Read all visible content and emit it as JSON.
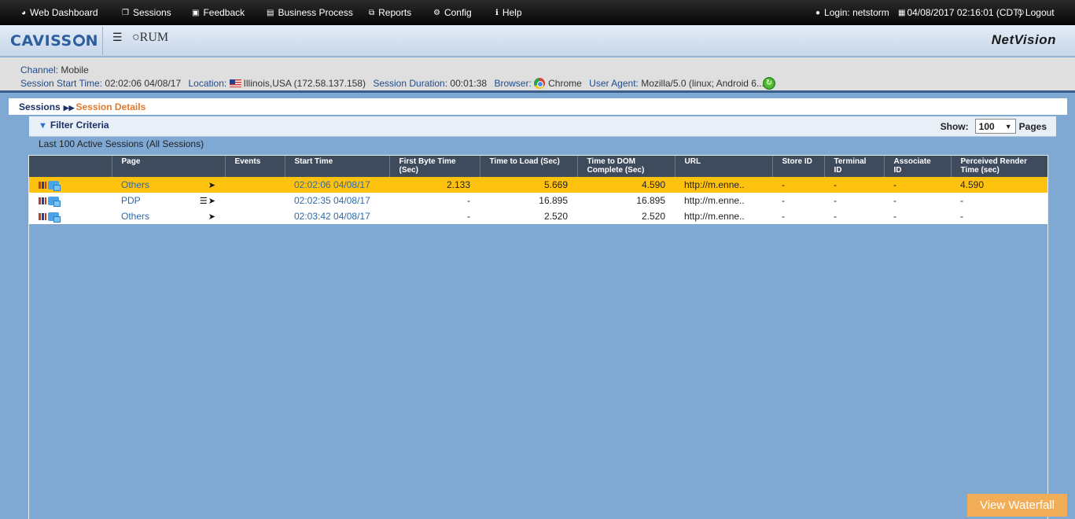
{
  "nav": {
    "items": [
      {
        "label": "Web Dashboard",
        "icon": "dashboard-icon",
        "glyph": "◕"
      },
      {
        "label": "Sessions",
        "icon": "sessions-icon",
        "glyph": "❐"
      },
      {
        "label": "Feedback",
        "icon": "feedback-icon",
        "glyph": "▣"
      },
      {
        "label": "Business Process",
        "icon": "business-process-icon",
        "glyph": "▤"
      },
      {
        "label": "Reports",
        "icon": "reports-icon",
        "glyph": "⧉"
      },
      {
        "label": "Config",
        "icon": "config-icon",
        "glyph": "⚙"
      },
      {
        "label": "Help",
        "icon": "help-icon",
        "glyph": "ℹ"
      }
    ],
    "login": "Login: netstorm",
    "datetime": "04/08/2017 02:16:01 (CDT)",
    "logout": "Logout"
  },
  "brand": {
    "logo_prefix": "CAVISS",
    "logo_suffix": "N",
    "rum": "RUM",
    "product": "NetVision"
  },
  "session": {
    "channel_label": "Channel:",
    "channel": "Mobile",
    "start_label": "Session Start Time:",
    "start": "02:02:06 04/08/17",
    "location_label": "Location:",
    "location": "Illinois,USA (172.58.137.158)",
    "duration_label": "Session Duration:",
    "duration": "00:01:38",
    "browser_label": "Browser:",
    "browser": "Chrome",
    "agent_label": "User Agent:",
    "agent": "Mozilla/5.0 (linux; Android 6...."
  },
  "breadcrumb": {
    "root": "Sessions",
    "current": "Session Details"
  },
  "filter": {
    "title": "Filter Criteria",
    "show_label": "Show:",
    "show_value": "100",
    "pages_label": "Pages"
  },
  "summary": "Last 100 Active Sessions (All Sessions)",
  "table": {
    "columns": [
      "",
      "Page",
      "Events",
      "Start Time",
      "First Byte Time (Sec)",
      "Time to Load (Sec)",
      "Time to DOM Complete (Sec)",
      "URL",
      "Store ID",
      "Terminal ID",
      "Associate ID",
      "Perceived Render Time (sec)"
    ],
    "rows": [
      {
        "page": "Others",
        "events": "",
        "start": "02:02:06 04/08/17",
        "first_byte": "2.133",
        "load": "5.669",
        "dom": "4.590",
        "url": "http://m.enne..",
        "store": "-",
        "terminal": "-",
        "associate": "-",
        "render": "4.590",
        "has_list": false
      },
      {
        "page": "PDP",
        "events": "",
        "start": "02:02:35 04/08/17",
        "first_byte": "-",
        "load": "16.895",
        "dom": "16.895",
        "url": "http://m.enne..",
        "store": "-",
        "terminal": "-",
        "associate": "-",
        "render": "-",
        "has_list": true
      },
      {
        "page": "Others",
        "events": "",
        "start": "02:03:42 04/08/17",
        "first_byte": "-",
        "load": "2.520",
        "dom": "2.520",
        "url": "http://m.enne..",
        "store": "-",
        "terminal": "-",
        "associate": "-",
        "render": "-",
        "has_list": false
      }
    ]
  },
  "waterfall_button": "View Waterfall",
  "colors": {
    "selected_row": "#ffc20e",
    "header_bg": "#3e4b5d",
    "link": "#2d6aa8",
    "accent_orange": "#e0792b",
    "waterfall": "#f2ad58"
  }
}
